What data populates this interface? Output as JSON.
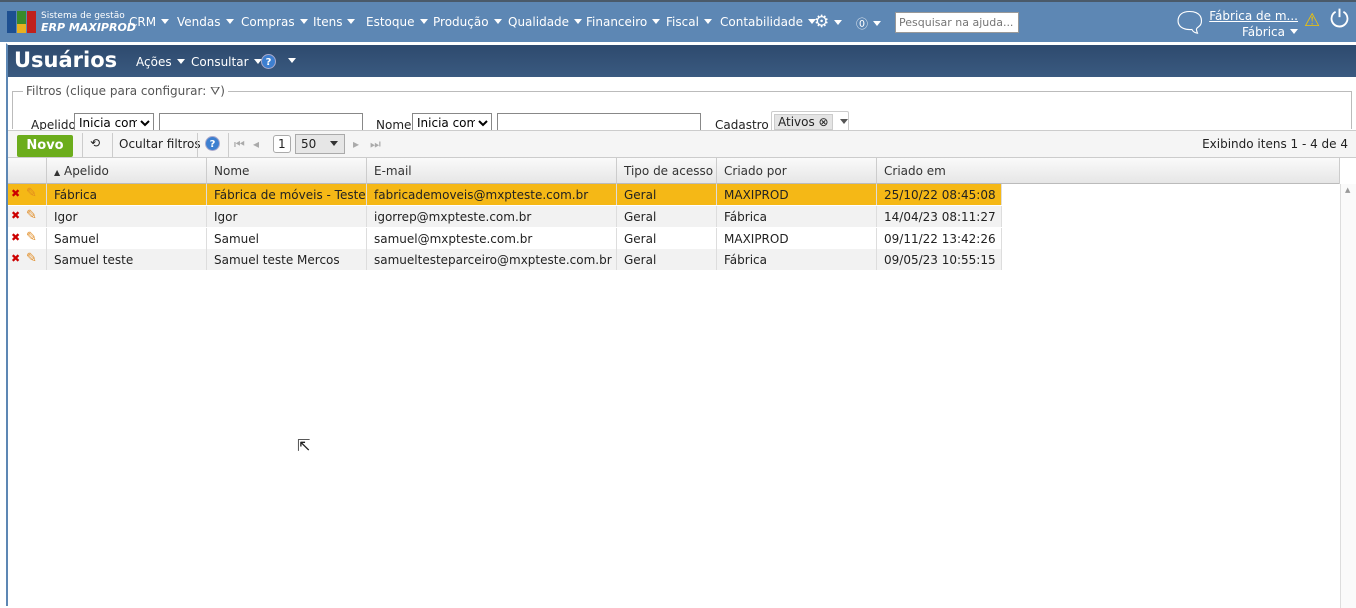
{
  "app": {
    "subtitle": "Sistema de gestão",
    "name": "ERP MAXIPROD"
  },
  "nav": [
    "CRM",
    "Vendas",
    "Compras",
    "Itens",
    "Estoque",
    "Produção",
    "Qualidade",
    "Financeiro",
    "Fiscal",
    "Contabilidade"
  ],
  "help_search_placeholder": "Pesquisar na ajuda...",
  "company": {
    "name": "Fábrica de m...",
    "user": "Fábrica"
  },
  "page": {
    "title": "Usuários",
    "actions": "Ações",
    "consult": "Consultar"
  },
  "filters": {
    "legend": "Filtros (clique para configurar:",
    "legend_end": ")",
    "apelido_label": "Apelido",
    "apelido_op": "Inicia com",
    "nome_label": "Nome",
    "nome_op": "Inicia com",
    "cadastro_label": "Cadastro",
    "cadastro_tag": "Ativos"
  },
  "toolbar": {
    "new": "Novo",
    "hide_filters": "Ocultar filtros",
    "page": "1",
    "page_size": "50",
    "info": "Exibindo itens 1 - 4 de 4"
  },
  "columns": [
    "Apelido",
    "Nome",
    "E-mail",
    "Tipo de acesso",
    "Criado por",
    "Criado em"
  ],
  "rows": [
    [
      "Fábrica",
      "Fábrica de móveis - Teste...",
      "fabricademoveis@mxpteste.com.br",
      "Geral",
      "MAXIPROD",
      "25/10/22 08:45:08"
    ],
    [
      "Igor",
      "Igor",
      "igorrep@mxpteste.com.br",
      "Geral",
      "Fábrica",
      "14/04/23 08:11:27"
    ],
    [
      "Samuel",
      "Samuel",
      "samuel@mxpteste.com.br",
      "Geral",
      "MAXIPROD",
      "09/11/22 13:42:26"
    ],
    [
      "Samuel teste",
      "Samuel teste Mercos",
      "samueltesteparceiro@mxpteste.com.br",
      "Geral",
      "Fábrica",
      "09/05/23 10:55:15"
    ]
  ]
}
